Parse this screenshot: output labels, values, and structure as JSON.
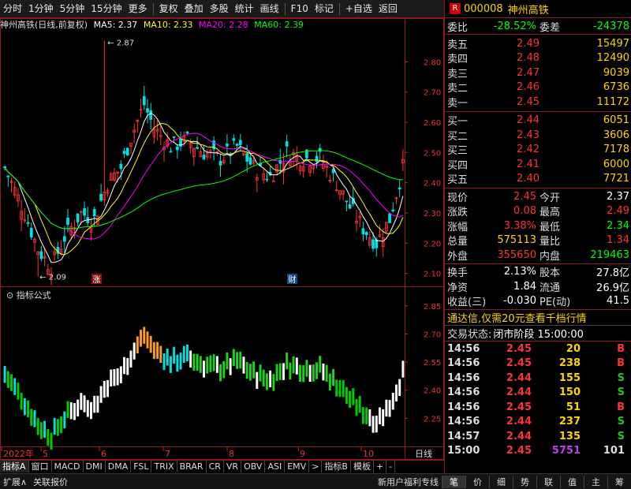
{
  "toolbar": {
    "items": [
      "分时",
      "1分钟",
      "5分钟",
      "15分钟",
      "更多",
      "复权",
      "叠加",
      "多股",
      "统计",
      "画线",
      "F10",
      "标记",
      "+自选",
      "返回"
    ]
  },
  "title": {
    "stock": "神州高铁(日线,前复权)",
    "ma5": "MA5: 2.37",
    "ma10": "MA10: 2.33",
    "ma20": "MA20: 2.28",
    "ma60": "MA60: 2.39"
  },
  "colors": {
    "up": "#ff3333",
    "down": "#00e0e0",
    "ma5": "#ffffff",
    "ma10": "#ffff00",
    "ma20": "#ff00ff",
    "ma60": "#00ff00",
    "accent_border": "#8a1c1c"
  },
  "chart_data": {
    "type": "candlestick",
    "y_ticks": [
      "2.80",
      "2.70",
      "2.60",
      "2.50",
      "2.40",
      "2.30",
      "2.20",
      "2.10"
    ],
    "high_label": "2.87",
    "low_label": "2.09",
    "marks": [
      "涨",
      "财"
    ],
    "indicator_title": "指标公式",
    "indicator_y_ticks": [
      "2.85",
      "2.70",
      "2.55",
      "2.40",
      "2.25"
    ],
    "date_labels": [
      "2022年",
      "5",
      "6",
      "7",
      "8",
      "9",
      "10"
    ],
    "period_label": "日线"
  },
  "tabs": [
    "指标A",
    "窗口",
    "MACD",
    "DMI",
    "DMA",
    "FSL",
    "TRIX",
    "BRAR",
    "CR",
    "VR",
    "OBV",
    "ASI",
    "EMV",
    ">",
    "指标B",
    "模板",
    "+",
    "-"
  ],
  "bottombar": {
    "left": [
      "扩展∧",
      "关联报价"
    ],
    "promo": "新用户福利专线",
    "buttons": [
      "笔",
      "价",
      "细",
      "势",
      "联",
      "值",
      "主",
      "筹"
    ]
  },
  "panel": {
    "code": "000008",
    "name": "神州高铁",
    "weibi_label": "委比",
    "weibi": "-28.52%",
    "weicha_label": "委差",
    "weicha": "-24378",
    "sell": [
      {
        "label": "卖五",
        "price": "2.49",
        "vol": "15497"
      },
      {
        "label": "卖四",
        "price": "2.48",
        "vol": "12490"
      },
      {
        "label": "卖三",
        "price": "2.47",
        "vol": "9039"
      },
      {
        "label": "卖二",
        "price": "2.46",
        "vol": "6736"
      },
      {
        "label": "卖一",
        "price": "2.45",
        "vol": "11172"
      }
    ],
    "buy": [
      {
        "label": "买一",
        "price": "2.44",
        "vol": "6051"
      },
      {
        "label": "买二",
        "price": "2.43",
        "vol": "3606"
      },
      {
        "label": "买三",
        "price": "2.42",
        "vol": "7178"
      },
      {
        "label": "买四",
        "price": "2.41",
        "vol": "6000"
      },
      {
        "label": "买五",
        "price": "2.40",
        "vol": "7721"
      }
    ],
    "stats": [
      {
        "l1": "现价",
        "v1": "2.45",
        "l2": "今开",
        "v2": "2.37"
      },
      {
        "l1": "涨跌",
        "v1": "0.08",
        "l2": "最高",
        "v2": "2.49"
      },
      {
        "l1": "涨幅",
        "v1": "3.38%",
        "l2": "最低",
        "v2": "2.34"
      },
      {
        "l1": "总量",
        "v1": "575113",
        "l2": "量比",
        "v2": "1.34"
      },
      {
        "l1": "外盘",
        "v1": "355650",
        "l2": "内盘",
        "v2": "219463"
      }
    ],
    "stats2": [
      {
        "l1": "换手",
        "v1": "2.13%",
        "l2": "股本",
        "v2": "27.8亿"
      },
      {
        "l1": "净资",
        "v1": "1.84",
        "l2": "流通",
        "v2": "26.9亿"
      },
      {
        "l1": "收益(三)",
        "v1": "-0.030",
        "l2": "PE(动)",
        "v2": "41.5"
      }
    ],
    "promo": "通达信,仅需20元查看千档行情",
    "status_label": "交易状态:",
    "status": "闭市阶段 15:00:00",
    "ticks": [
      {
        "t": "14:56",
        "p": "2.45",
        "v": "20",
        "d": "B"
      },
      {
        "t": "14:56",
        "p": "2.45",
        "v": "238",
        "d": "B"
      },
      {
        "t": "14:56",
        "p": "2.44",
        "v": "155",
        "d": "S"
      },
      {
        "t": "14:56",
        "p": "2.44",
        "v": "150",
        "d": "S"
      },
      {
        "t": "14:56",
        "p": "2.45",
        "v": "51",
        "d": "B"
      },
      {
        "t": "14:56",
        "p": "2.44",
        "v": "237",
        "d": "S"
      },
      {
        "t": "14:57",
        "p": "2.44",
        "v": "135",
        "d": "S"
      },
      {
        "t": "15:00",
        "p": "2.45",
        "v": "5751",
        "d": "101"
      }
    ]
  }
}
